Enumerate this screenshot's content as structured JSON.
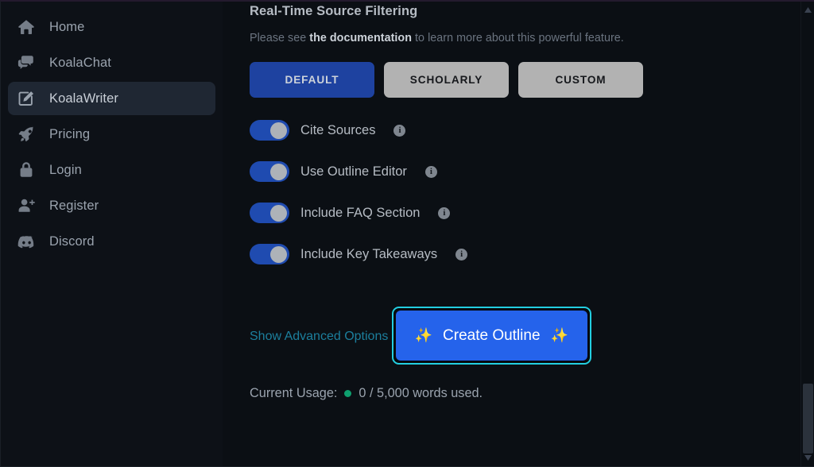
{
  "sidebar": {
    "items": [
      {
        "label": "Home",
        "icon": "home-icon",
        "active": false
      },
      {
        "label": "KoalaChat",
        "icon": "chat-icon",
        "active": false
      },
      {
        "label": "KoalaWriter",
        "icon": "pencil-square-icon",
        "active": true
      },
      {
        "label": "Pricing",
        "icon": "rocket-icon",
        "active": false
      },
      {
        "label": "Login",
        "icon": "lock-icon",
        "active": false
      },
      {
        "label": "Register",
        "icon": "user-plus-icon",
        "active": false
      },
      {
        "label": "Discord",
        "icon": "discord-icon",
        "active": false
      }
    ]
  },
  "main": {
    "section_title": "Real-Time Source Filtering",
    "description": {
      "before": "Please see ",
      "link": "the documentation",
      "after": " to learn more about this powerful feature."
    },
    "mode_buttons": [
      {
        "label": "DEFAULT",
        "selected": true
      },
      {
        "label": "SCHOLARLY",
        "selected": false
      },
      {
        "label": "CUSTOM",
        "selected": false
      }
    ],
    "toggles": [
      {
        "label": "Cite Sources",
        "on": true,
        "info": "i"
      },
      {
        "label": "Use Outline Editor",
        "on": true,
        "info": "i"
      },
      {
        "label": "Include FAQ Section",
        "on": true,
        "info": "i"
      },
      {
        "label": "Include Key Takeaways",
        "on": true,
        "info": "i"
      }
    ],
    "advanced_link": "Show Advanced Options",
    "cta": {
      "label": "Create Outline",
      "spark_left": "✨",
      "spark_right": "✨"
    },
    "usage": {
      "label": "Current Usage:",
      "value": "0 / 5,000 words used."
    }
  },
  "scrollbar": {
    "up_arrow": "▲",
    "down_arrow": "▼"
  },
  "colors": {
    "background": "#0b0f14",
    "sidebar": "#0d1117",
    "accent_blue": "#2563eb",
    "primary_blue": "#1e42a0",
    "focus_ring": "#23cee0",
    "link_teal": "#1c7f9d",
    "usage_dot": "#0e9f6e",
    "spark_gold": "#fbbf3c"
  }
}
